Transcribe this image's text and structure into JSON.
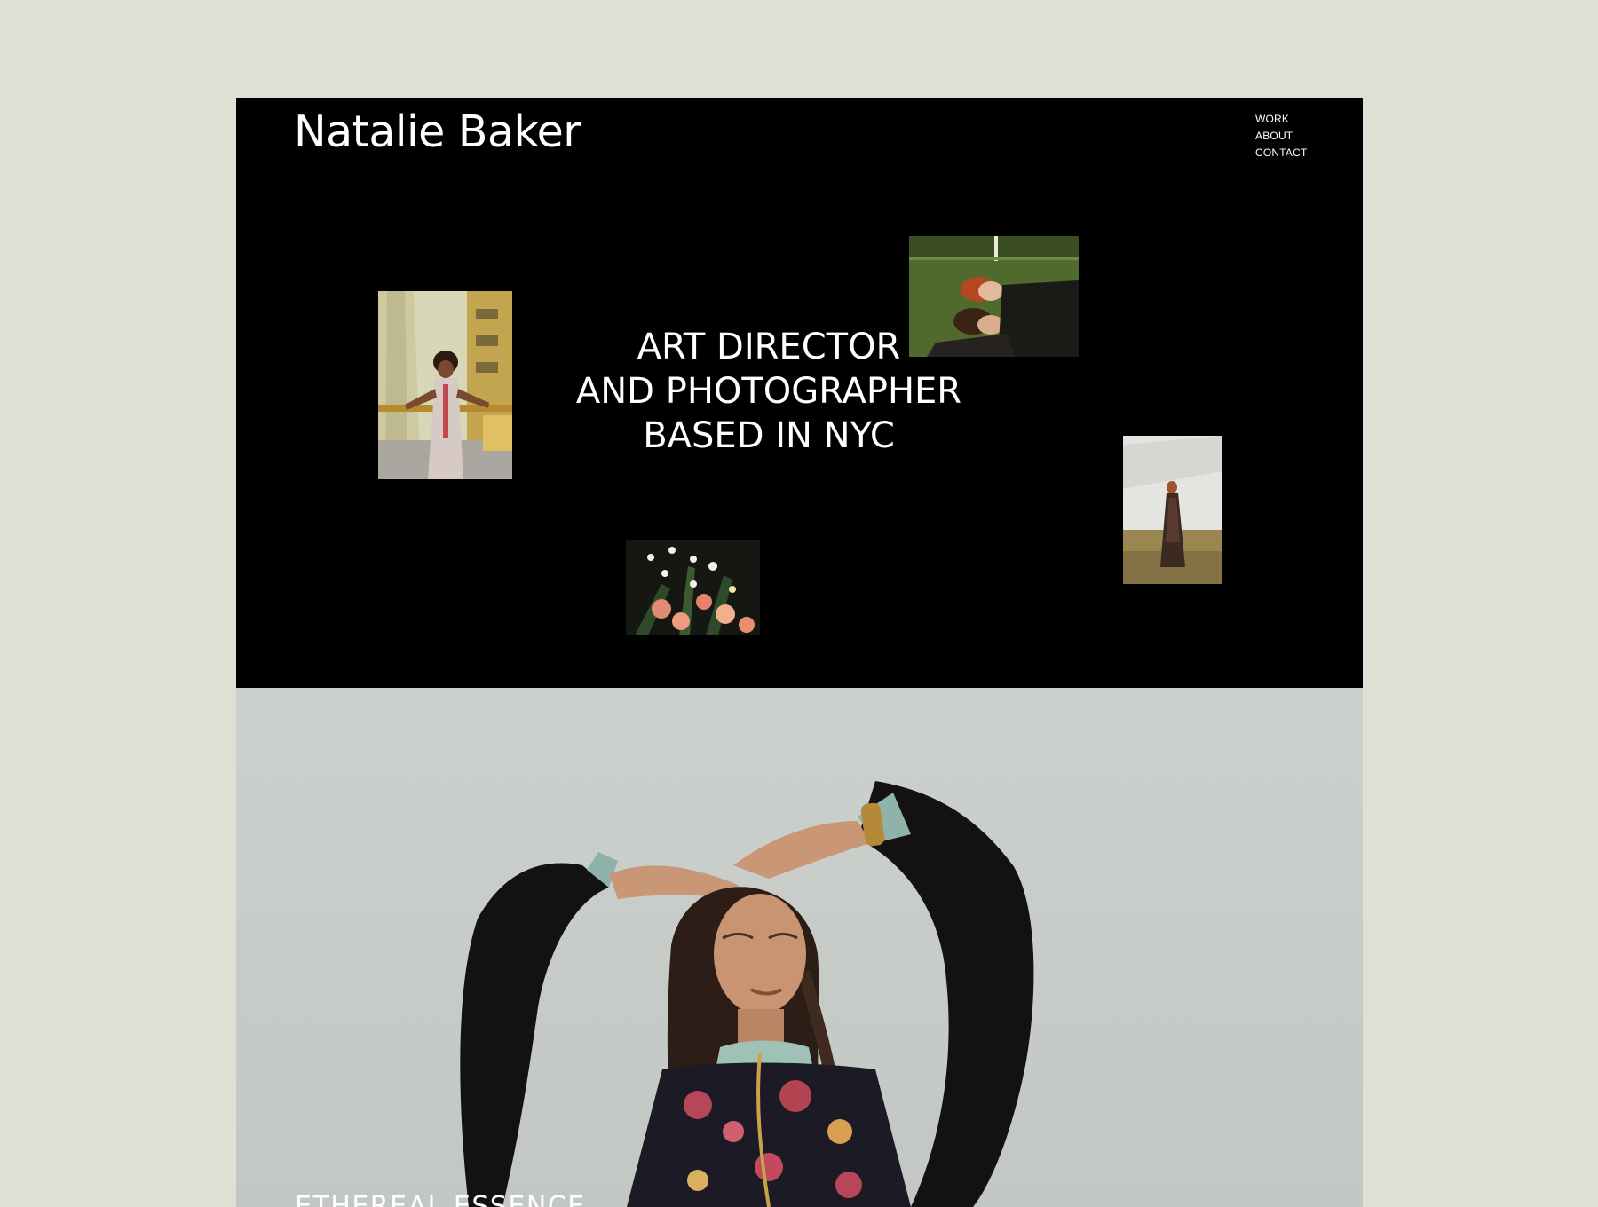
{
  "brand": {
    "name": "Natalie Baker"
  },
  "nav": {
    "items": [
      {
        "label": "WORK"
      },
      {
        "label": "ABOUT"
      },
      {
        "label": "CONTACT"
      }
    ]
  },
  "hero": {
    "tagline_lines": [
      "ART DIRECTOR",
      "AND PHOTOGRAPHER",
      "BASED IN NYC"
    ]
  },
  "featured_project": {
    "title": "ETHEREAL ESSENCE"
  },
  "colors": {
    "page_background": "#dfdfd3",
    "hero_background": "#000000",
    "text_on_dark": "#ffffff"
  }
}
